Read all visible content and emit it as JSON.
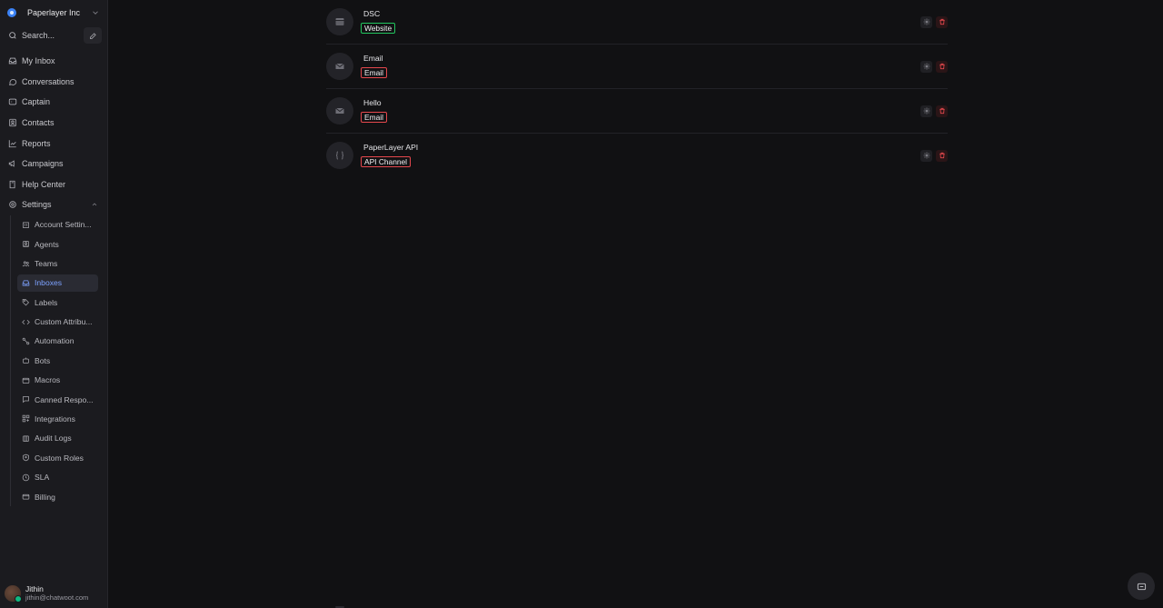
{
  "workspace": {
    "name": "Paperlayer Inc"
  },
  "search": {
    "label": "Search..."
  },
  "nav": {
    "my_inbox": "My Inbox",
    "conversations": "Conversations",
    "captain": "Captain",
    "contacts": "Contacts",
    "reports": "Reports",
    "campaigns": "Campaigns",
    "help_center": "Help Center",
    "settings": "Settings"
  },
  "settings_items": [
    {
      "label": "Account Settin...",
      "icon": "building-icon"
    },
    {
      "label": "Agents",
      "icon": "agent-icon"
    },
    {
      "label": "Teams",
      "icon": "users-icon"
    },
    {
      "label": "Inboxes",
      "icon": "inbox-icon",
      "active": true
    },
    {
      "label": "Labels",
      "icon": "tag-icon"
    },
    {
      "label": "Custom Attribu...",
      "icon": "code-icon"
    },
    {
      "label": "Automation",
      "icon": "automation-icon"
    },
    {
      "label": "Bots",
      "icon": "bot-icon"
    },
    {
      "label": "Macros",
      "icon": "macro-icon"
    },
    {
      "label": "Canned Respo...",
      "icon": "canned-icon"
    },
    {
      "label": "Integrations",
      "icon": "integrations-icon"
    },
    {
      "label": "Audit Logs",
      "icon": "audit-icon"
    },
    {
      "label": "Custom Roles",
      "icon": "shield-icon"
    },
    {
      "label": "SLA",
      "icon": "clock-icon"
    },
    {
      "label": "Billing",
      "icon": "card-icon"
    }
  ],
  "user": {
    "name": "Jithin",
    "email": "jithin@chatwoot.com"
  },
  "inboxes": [
    {
      "name": "DSC",
      "channel": "Website",
      "icon": "website-icon",
      "chip_color": "#22c55e"
    },
    {
      "name": "Email",
      "channel": "Email",
      "icon": "mail-icon",
      "chip_color": "#e5484d"
    },
    {
      "name": "Hello",
      "channel": "Email",
      "icon": "mail-icon",
      "chip_color": "#e5484d"
    },
    {
      "name": "PaperLayer API",
      "channel": "API Channel",
      "icon": "braces-icon",
      "chip_color": "#e5484d"
    }
  ]
}
